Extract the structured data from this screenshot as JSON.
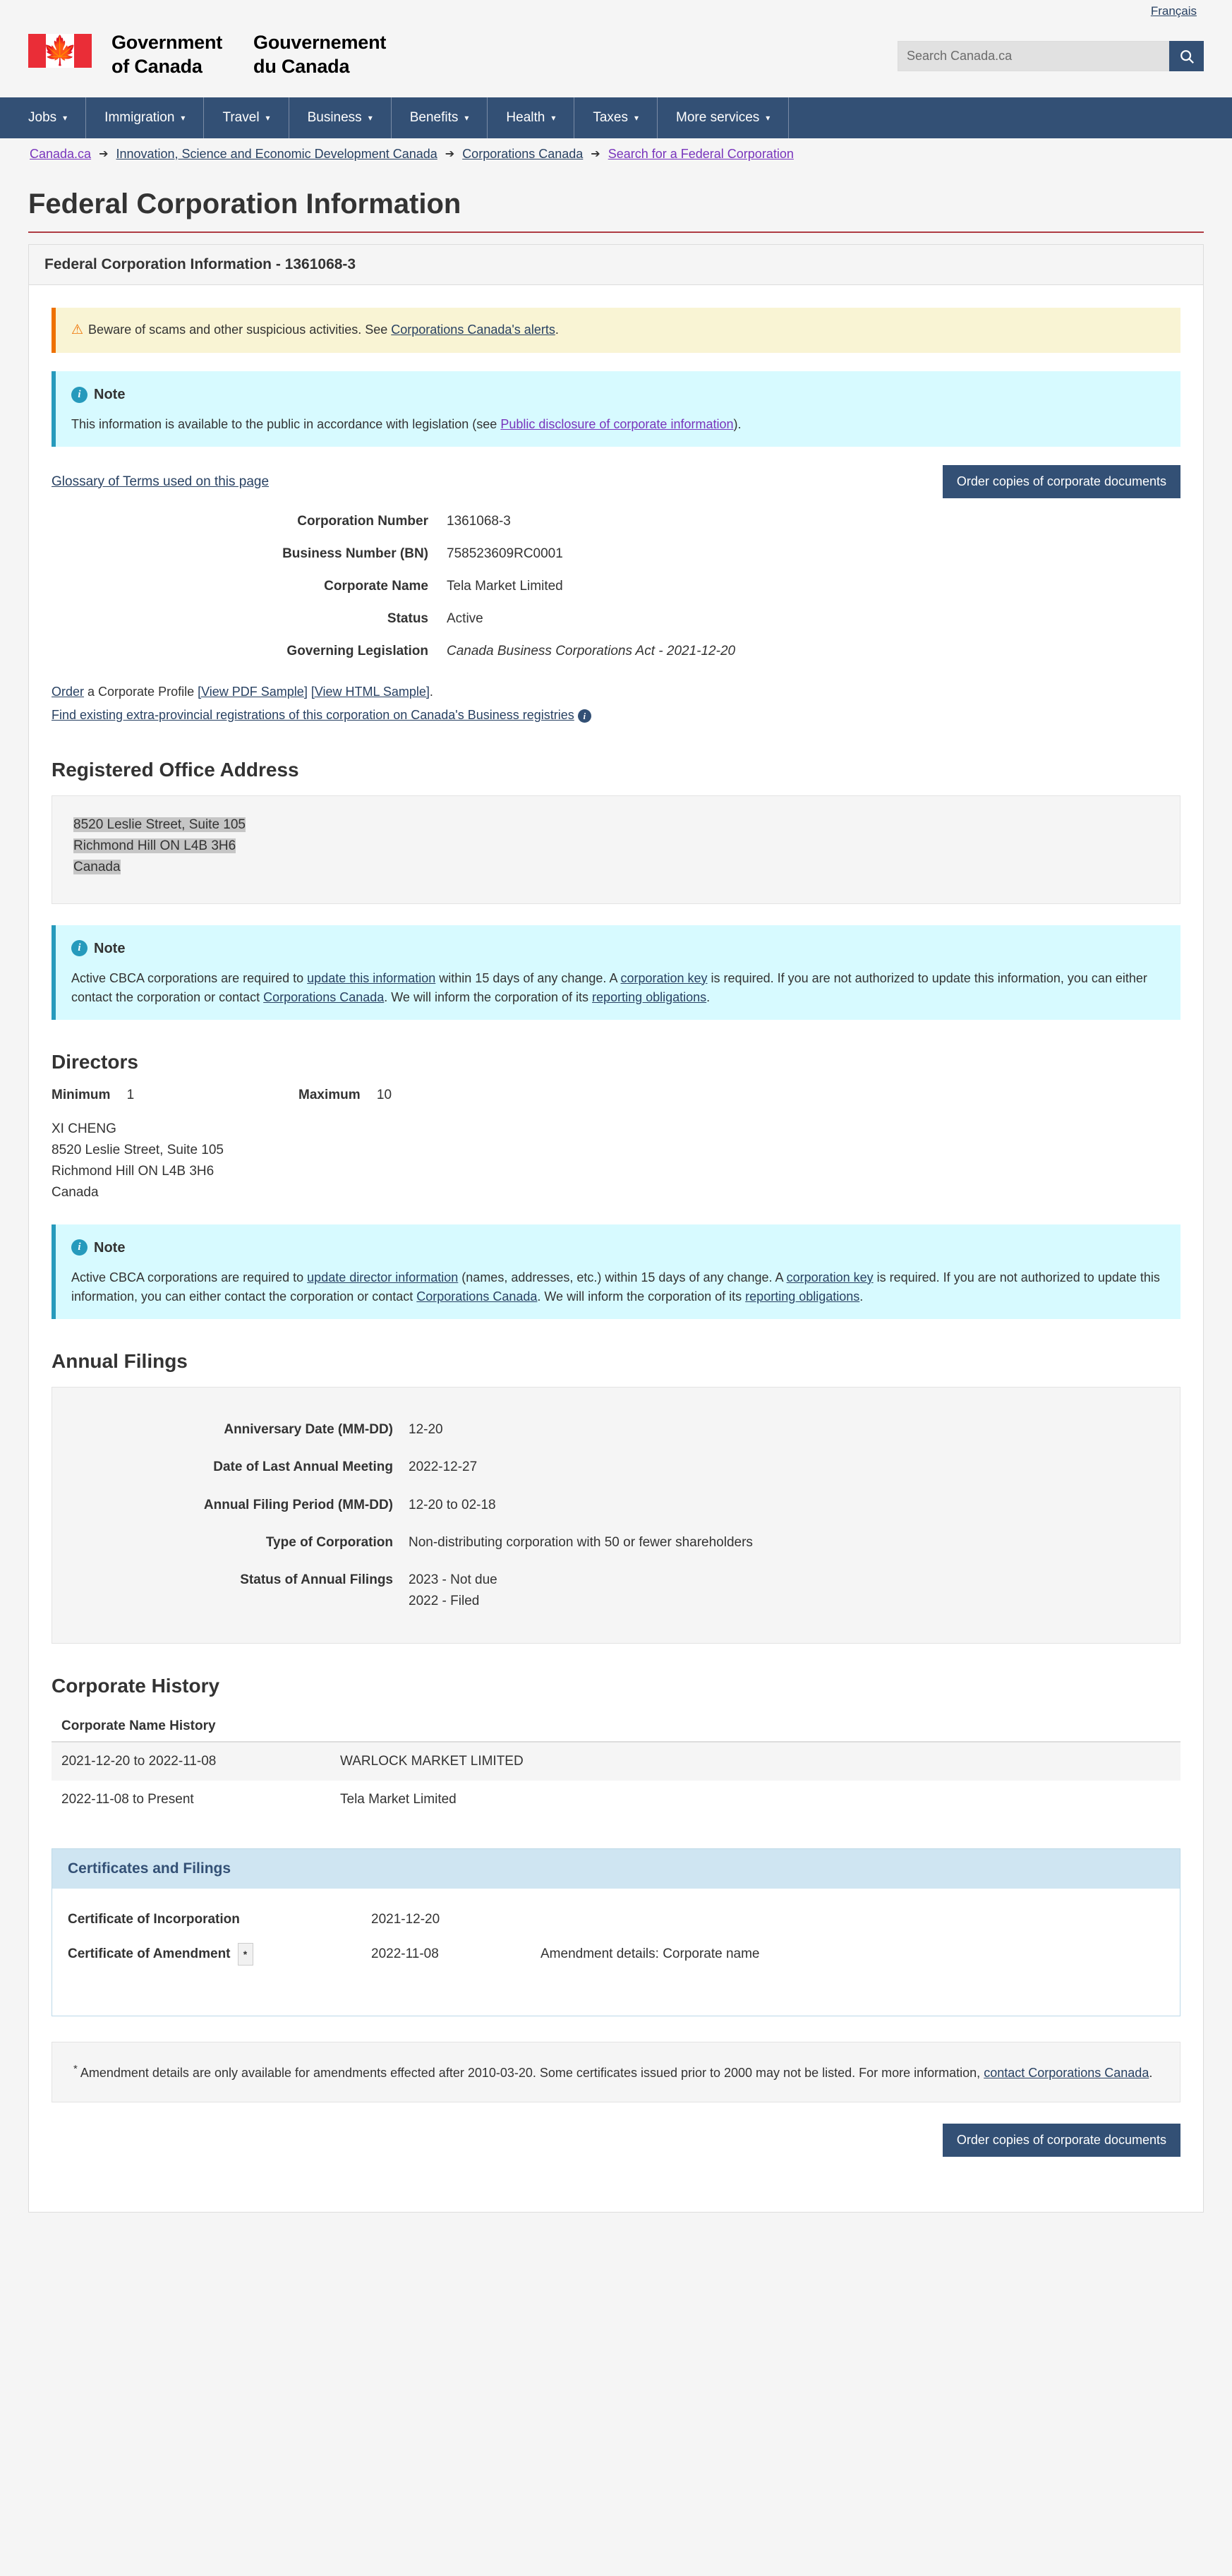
{
  "header": {
    "lang_toggle": "Français",
    "wordmark_en": "Government\nof Canada",
    "wordmark_fr": "Gouvernement\ndu Canada",
    "search_placeholder": "Search Canada.ca",
    "search_value": "",
    "search_icon": "search-icon",
    "flag_icon": "canada-flag-icon"
  },
  "nav": {
    "items": [
      {
        "label": "Jobs",
        "caret": "▾"
      },
      {
        "label": "Immigration",
        "caret": "▾"
      },
      {
        "label": "Travel",
        "caret": "▾"
      },
      {
        "label": "Business",
        "caret": "▾"
      },
      {
        "label": "Benefits",
        "caret": "▾"
      },
      {
        "label": "Health",
        "caret": "▾"
      },
      {
        "label": "Taxes",
        "caret": "▾"
      },
      {
        "label": "More services",
        "caret": "▾"
      }
    ]
  },
  "breadcrumb": {
    "separator": "➔",
    "items": [
      {
        "label": "Canada.ca",
        "visited": true
      },
      {
        "label": "Innovation, Science and Economic Development Canada",
        "visited": false
      },
      {
        "label": "Corporations Canada",
        "visited": false
      },
      {
        "label": "Search for a Federal Corporation",
        "visited": true
      }
    ]
  },
  "page": {
    "title": "Federal Corporation Information",
    "panel_heading": "Federal Corporation Information - 1361068-3"
  },
  "alerts": {
    "scam": {
      "icon": "warning-triangle-icon",
      "text_before": "Beware of scams and other suspicious activities. See ",
      "link": "Corporations Canada's alerts",
      "text_after": "."
    },
    "disclosure": {
      "icon": "info-circle-icon",
      "title": "Note",
      "text_before": "This information is available to the public in accordance with legislation (see ",
      "link": "Public disclosure of corporate information",
      "text_after": ")."
    }
  },
  "toolbar": {
    "glossary_link": "Glossary of Terms used on this page",
    "order_button": "Order copies of corporate documents"
  },
  "corporation": {
    "fields": [
      {
        "label": "Corporation Number",
        "value": "1361068-3",
        "italic": false
      },
      {
        "label": "Business Number (BN)",
        "value": "758523609RC0001",
        "italic": false
      },
      {
        "label": "Corporate Name",
        "value": "Tela Market Limited",
        "italic": false
      },
      {
        "label": "Status",
        "value": "Active",
        "italic": false
      },
      {
        "label": "Governing Legislation",
        "value": "Canada Business Corporations Act - 2021-12-20",
        "italic": true
      }
    ]
  },
  "profile_links": {
    "order_link": "Order",
    "order_rest": " a Corporate Profile ",
    "pdf_sample": "[View PDF Sample]",
    "html_sample": "[View HTML Sample]",
    "period": ".",
    "registries_link": "Find existing extra-provincial registrations of this corporation on Canada's Business registries",
    "info_icon": "info-circle-icon"
  },
  "registered_office": {
    "heading": "Registered Office Address",
    "address_lines": [
      "8520 Leslie Street, Suite 105",
      "Richmond Hill ON L4B 3H6",
      "Canada"
    ],
    "note": {
      "icon": "info-circle-icon",
      "title": "Note",
      "p1": "Active CBCA corporations are required to ",
      "link1": "update this information",
      "p2": " within 15 days of any change. A ",
      "link2": "corporation key",
      "p3": " is required. If you are not authorized to update this information, you can either contact the corporation or contact ",
      "link3": "Corporations Canada",
      "p4": ". We will inform the corporation of its ",
      "link4": "reporting obligations",
      "p5": "."
    }
  },
  "directors": {
    "heading": "Directors",
    "minimum_label": "Minimum",
    "minimum_value": "1",
    "maximum_label": "Maximum",
    "maximum_value": "10",
    "list": [
      {
        "name": "XI CHENG",
        "address_lines": [
          "8520 Leslie Street, Suite 105",
          "Richmond Hill ON L4B 3H6",
          "Canada"
        ]
      }
    ],
    "note": {
      "icon": "info-circle-icon",
      "title": "Note",
      "p1": "Active CBCA corporations are required to ",
      "link1": "update director information",
      "p2": " (names, addresses, etc.) within 15 days of any change. A ",
      "link2": "corporation key",
      "p3": " is required. If you are not authorized to update this information, you can either contact the corporation or contact ",
      "link3": "Corporations Canada",
      "p4": ". We will inform the corporation of its ",
      "link4": "reporting obligations",
      "p5": "."
    }
  },
  "annual_filings": {
    "heading": "Annual Filings",
    "fields": [
      {
        "label": "Anniversary Date (MM-DD)",
        "value": "12-20"
      },
      {
        "label": "Date of Last Annual Meeting",
        "value": "2022-12-27"
      },
      {
        "label": "Annual Filing Period (MM-DD)",
        "value": "12-20 to 02-18"
      },
      {
        "label": "Type of Corporation",
        "value": "Non-distributing corporation with 50 or fewer shareholders"
      }
    ],
    "status_label": "Status of Annual Filings",
    "status_values": [
      "2023 - Not due",
      "2022 - Filed"
    ]
  },
  "corporate_history": {
    "heading": "Corporate History",
    "name_history_header": "Corporate Name History",
    "rows": [
      {
        "period": "2021-12-20 to 2022-11-08",
        "name": "WARLOCK MARKET LIMITED"
      },
      {
        "period": "2022-11-08 to Present",
        "name": "Tela Market Limited"
      }
    ]
  },
  "certificates": {
    "heading": "Certificates and Filings",
    "rows": [
      {
        "name": "Certificate of Incorporation",
        "star": "",
        "date": "2021-12-20",
        "details": ""
      },
      {
        "name": "Certificate of Amendment",
        "star": "*",
        "date": "2022-11-08",
        "details": "Amendment details: Corporate name"
      }
    ]
  },
  "footnote": {
    "marker": "*",
    "text_before": " Amendment details are only available for amendments effected after 2010-03-20. Some certificates issued prior to 2000 may not be listed. For more information, ",
    "link": "contact Corporations Canada",
    "text_after": "."
  },
  "bottom": {
    "order_button": "Order copies of corporate documents"
  },
  "colors": {
    "nav_blue": "#335075",
    "brand_red": "#af3c43",
    "link_blue": "#284162",
    "visited_purple": "#7834bc",
    "info_bg": "#d7faff",
    "warning_bg": "#f9f4d4",
    "cert_head_bg": "#cfe5f2"
  }
}
